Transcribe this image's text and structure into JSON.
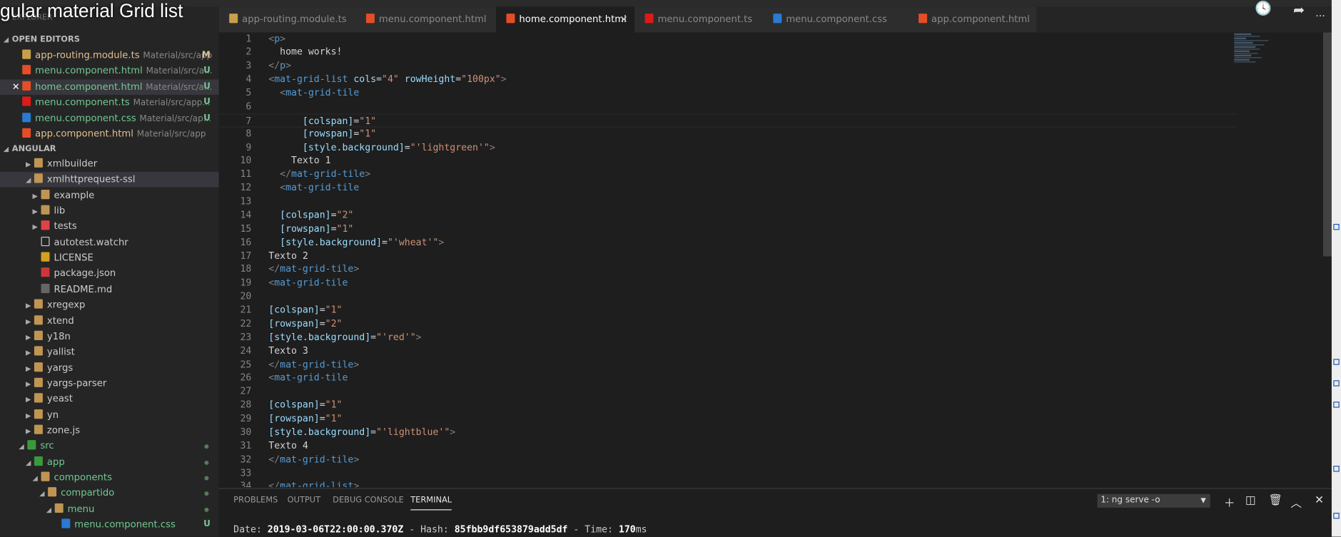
{
  "video_title": "gular material Grid list",
  "explorer_label": "EXPLORER",
  "open_editors": {
    "title": "OPEN EDITORS",
    "items": [
      {
        "name": "app-routing.module.ts",
        "path": "Material/src/app",
        "badge": "M",
        "icon": "angular-ts-icon",
        "color": "#e2c08d",
        "iconColor": "#c9a04a"
      },
      {
        "name": "menu.component.html",
        "path": "Material/src/a...",
        "badge": "U",
        "icon": "html5-icon",
        "color": "#73c991",
        "iconColor": "#e44d26"
      },
      {
        "name": "home.component.html",
        "path": "Material/src/a...",
        "badge": "U",
        "icon": "html5-icon",
        "color": "#73c991",
        "iconColor": "#e44d26",
        "selected": true
      },
      {
        "name": "menu.component.ts",
        "path": "Material/src/app...",
        "badge": "U",
        "icon": "angular-icon",
        "color": "#73c991",
        "iconColor": "#dd1b16"
      },
      {
        "name": "menu.component.css",
        "path": "Material/src/ap...",
        "badge": "U",
        "icon": "css3-icon",
        "color": "#73c991",
        "iconColor": "#2a7ad2"
      },
      {
        "name": "app.component.html",
        "path": "Material/src/app",
        "badge": "",
        "icon": "html5-icon",
        "color": "#e2c08d",
        "iconColor": "#e44d26"
      }
    ]
  },
  "tree": {
    "title": "ANGULAR",
    "items": [
      {
        "name": "xmlbuilder",
        "depth": 1,
        "type": "folder",
        "expanded": false
      },
      {
        "name": "xmlhttprequest-ssl",
        "depth": 1,
        "type": "folder",
        "expanded": true,
        "selected": true
      },
      {
        "name": "example",
        "depth": 2,
        "type": "folder",
        "expanded": false
      },
      {
        "name": "lib",
        "depth": 2,
        "type": "folder",
        "expanded": false
      },
      {
        "name": "tests",
        "depth": 2,
        "type": "folder-test",
        "expanded": false
      },
      {
        "name": "autotest.watchr",
        "depth": 2,
        "type": "file"
      },
      {
        "name": "LICENSE",
        "depth": 2,
        "type": "license"
      },
      {
        "name": "package.json",
        "depth": 2,
        "type": "npm"
      },
      {
        "name": "README.md",
        "depth": 2,
        "type": "md"
      },
      {
        "name": "xregexp",
        "depth": 1,
        "type": "folder",
        "expanded": false
      },
      {
        "name": "xtend",
        "depth": 1,
        "type": "folder",
        "expanded": false
      },
      {
        "name": "y18n",
        "depth": 1,
        "type": "folder",
        "expanded": false
      },
      {
        "name": "yallist",
        "depth": 1,
        "type": "folder",
        "expanded": false
      },
      {
        "name": "yargs",
        "depth": 1,
        "type": "folder",
        "expanded": false
      },
      {
        "name": "yargs-parser",
        "depth": 1,
        "type": "folder",
        "expanded": false
      },
      {
        "name": "yeast",
        "depth": 1,
        "type": "folder",
        "expanded": false
      },
      {
        "name": "yn",
        "depth": 1,
        "type": "folder",
        "expanded": false
      },
      {
        "name": "zone.js",
        "depth": 1,
        "type": "folder",
        "expanded": false
      },
      {
        "name": "src",
        "depth": 0,
        "type": "folder-src",
        "expanded": true,
        "git": "dot",
        "color": "#73c991"
      },
      {
        "name": "app",
        "depth": 1,
        "type": "folder-src",
        "expanded": true,
        "git": "dot",
        "color": "#73c991"
      },
      {
        "name": "components",
        "depth": 2,
        "type": "folder",
        "expanded": true,
        "git": "dot",
        "color": "#73c991"
      },
      {
        "name": "compartido",
        "depth": 3,
        "type": "folder",
        "expanded": true,
        "git": "dot",
        "color": "#73c991"
      },
      {
        "name": "menu",
        "depth": 4,
        "type": "folder",
        "expanded": true,
        "git": "dot",
        "color": "#73c991"
      },
      {
        "name": "menu.component.css",
        "depth": 5,
        "type": "css",
        "git": "U",
        "color": "#73c991"
      }
    ]
  },
  "tabs": [
    {
      "label": "app-routing.module.ts",
      "icon": "angular-ts-icon",
      "iconColor": "#c9a04a"
    },
    {
      "label": "menu.component.html",
      "icon": "html5-icon",
      "iconColor": "#e44d26"
    },
    {
      "label": "home.component.html",
      "icon": "html5-icon",
      "iconColor": "#e44d26",
      "active": true,
      "close": "×"
    },
    {
      "label": "menu.component.ts",
      "icon": "angular-icon",
      "iconColor": "#dd1b16"
    },
    {
      "label": "menu.component.css",
      "icon": "css3-icon",
      "iconColor": "#2a7ad2"
    },
    {
      "label": "app.component.html",
      "icon": "html5-icon",
      "iconColor": "#e44d26"
    }
  ],
  "code": [
    [
      [
        "b",
        "<"
      ],
      [
        "t",
        "p"
      ],
      [
        "b",
        ">"
      ]
    ],
    [
      [
        "x",
        "  home works!"
      ]
    ],
    [
      [
        "b",
        "</"
      ],
      [
        "t",
        "p"
      ],
      [
        "b",
        ">"
      ]
    ],
    [
      [
        "b",
        "<"
      ],
      [
        "t",
        "mat-grid-list"
      ],
      [
        "x",
        " "
      ],
      [
        "a",
        "cols"
      ],
      [
        "x",
        "="
      ],
      [
        "s",
        "\"4\""
      ],
      [
        "x",
        " "
      ],
      [
        "a",
        "rowHeight"
      ],
      [
        "x",
        "="
      ],
      [
        "s",
        "\"100px\""
      ],
      [
        "b",
        ">"
      ]
    ],
    [
      [
        "x",
        "  "
      ],
      [
        "b",
        "<"
      ],
      [
        "t",
        "mat-grid-tile"
      ]
    ],
    [],
    [
      [
        "x",
        "      "
      ],
      [
        "a",
        "[colspan]"
      ],
      [
        "x",
        "="
      ],
      [
        "s",
        "\"1\""
      ]
    ],
    [
      [
        "x",
        "      "
      ],
      [
        "a",
        "[rowspan]"
      ],
      [
        "x",
        "="
      ],
      [
        "s",
        "\"1\""
      ]
    ],
    [
      [
        "x",
        "      "
      ],
      [
        "a",
        "[style.background]"
      ],
      [
        "x",
        "="
      ],
      [
        "s",
        "\"'lightgreen'\""
      ],
      [
        "b",
        ">"
      ]
    ],
    [
      [
        "x",
        "    Texto 1"
      ]
    ],
    [
      [
        "x",
        "  "
      ],
      [
        "b",
        "</"
      ],
      [
        "t",
        "mat-grid-tile"
      ],
      [
        "b",
        ">"
      ]
    ],
    [
      [
        "x",
        "  "
      ],
      [
        "b",
        "<"
      ],
      [
        "t",
        "mat-grid-tile"
      ]
    ],
    [],
    [
      [
        "x",
        "  "
      ],
      [
        "a",
        "[colspan]"
      ],
      [
        "x",
        "="
      ],
      [
        "s",
        "\"2\""
      ]
    ],
    [
      [
        "x",
        "  "
      ],
      [
        "a",
        "[rowspan]"
      ],
      [
        "x",
        "="
      ],
      [
        "s",
        "\"1\""
      ]
    ],
    [
      [
        "x",
        "  "
      ],
      [
        "a",
        "[style.background]"
      ],
      [
        "x",
        "="
      ],
      [
        "s",
        "\"'wheat'\""
      ],
      [
        "b",
        ">"
      ]
    ],
    [
      [
        "x",
        "Texto 2"
      ]
    ],
    [
      [
        "b",
        "</"
      ],
      [
        "t",
        "mat-grid-tile"
      ],
      [
        "b",
        ">"
      ]
    ],
    [
      [
        "b",
        "<"
      ],
      [
        "t",
        "mat-grid-tile"
      ]
    ],
    [],
    [
      [
        "a",
        "[colspan]"
      ],
      [
        "x",
        "="
      ],
      [
        "s",
        "\"1\""
      ]
    ],
    [
      [
        "a",
        "[rowspan]"
      ],
      [
        "x",
        "="
      ],
      [
        "s",
        "\"2\""
      ]
    ],
    [
      [
        "a",
        "[style.background]"
      ],
      [
        "x",
        "="
      ],
      [
        "s",
        "\"'red'\""
      ],
      [
        "b",
        ">"
      ]
    ],
    [
      [
        "x",
        "Texto 3"
      ]
    ],
    [
      [
        "b",
        "</"
      ],
      [
        "t",
        "mat-grid-tile"
      ],
      [
        "b",
        ">"
      ]
    ],
    [
      [
        "b",
        "<"
      ],
      [
        "t",
        "mat-grid-tile"
      ]
    ],
    [],
    [
      [
        "a",
        "[colspan]"
      ],
      [
        "x",
        "="
      ],
      [
        "s",
        "\"1\""
      ]
    ],
    [
      [
        "a",
        "[rowspan]"
      ],
      [
        "x",
        "="
      ],
      [
        "s",
        "\"1\""
      ]
    ],
    [
      [
        "a",
        "[style.background]"
      ],
      [
        "x",
        "="
      ],
      [
        "s",
        "\"'lightblue'\""
      ],
      [
        "b",
        ">"
      ]
    ],
    [
      [
        "x",
        "Texto 4"
      ]
    ],
    [
      [
        "b",
        "</"
      ],
      [
        "t",
        "mat-grid-tile"
      ],
      [
        "b",
        ">"
      ]
    ],
    [],
    [
      [
        "b",
        "</"
      ],
      [
        "t",
        "mat-grid-list"
      ],
      [
        "b",
        ">"
      ]
    ]
  ],
  "current_line": 7,
  "panel": {
    "tabs": [
      "PROBLEMS",
      "OUTPUT",
      "DEBUG CONSOLE",
      "TERMINAL"
    ],
    "active_tab": "TERMINAL",
    "terminal_select": "1: ng serve -o",
    "terminal_line": {
      "l1": "Date: ",
      "date": "2019-03-06T22:00:00.370Z",
      "l2": " - Hash: ",
      "hash": "85fbb9df653879add5df",
      "l3": " - Time: ",
      "time": "170",
      "l4": "ms"
    }
  },
  "more_actions": "..."
}
